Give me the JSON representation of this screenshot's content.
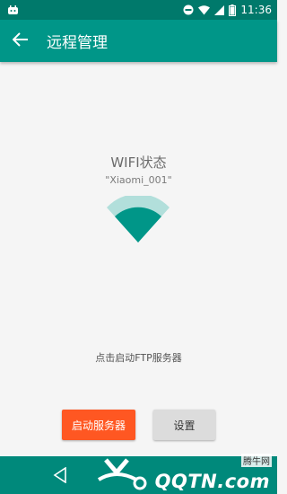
{
  "status_bar": {
    "time": "11:36",
    "icons": [
      "android-debug-icon",
      "dnd-icon",
      "wifi-icon",
      "signal-icon",
      "battery-icon"
    ]
  },
  "app_bar": {
    "title": "远程管理",
    "back_icon": "arrow-left-icon"
  },
  "wifi": {
    "title": "WIFI状态",
    "ssid": "\"Xiaomi_001\"",
    "signal_level": 0.75
  },
  "hint": "点击启动FTP服务器",
  "buttons": {
    "start_label": "启动服务器",
    "settings_label": "设置"
  },
  "watermark": {
    "brand": "QQTN.com",
    "sub": "腾牛网"
  },
  "colors": {
    "primary": "#009688",
    "primary_dark": "#00796b",
    "accent": "#ff5722",
    "wifi_active": "#009688",
    "wifi_inactive": "#b2dfdb"
  }
}
